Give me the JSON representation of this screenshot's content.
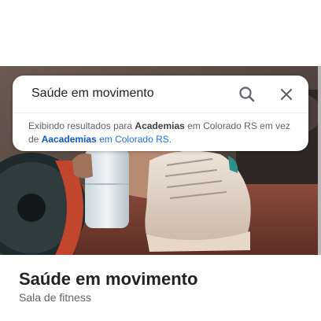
{
  "search": {
    "query": "Saúde em movimento",
    "correction": {
      "prefix": "Exibindo resultados para ",
      "shown_term": "Academias",
      "shown_location": " em Colorado RS",
      "middle": " em vez de ",
      "original_term": "Aacademias",
      "original_location": " em Colorado RS",
      "suffix": "."
    }
  },
  "place": {
    "name": "Saúde em movimento",
    "category": "Sala de fitness"
  },
  "icons": {
    "search": "search-icon",
    "close": "close-icon"
  },
  "colors": {
    "link": "#1a73e8",
    "text_primary": "#202124",
    "text_secondary": "#5f6368"
  }
}
